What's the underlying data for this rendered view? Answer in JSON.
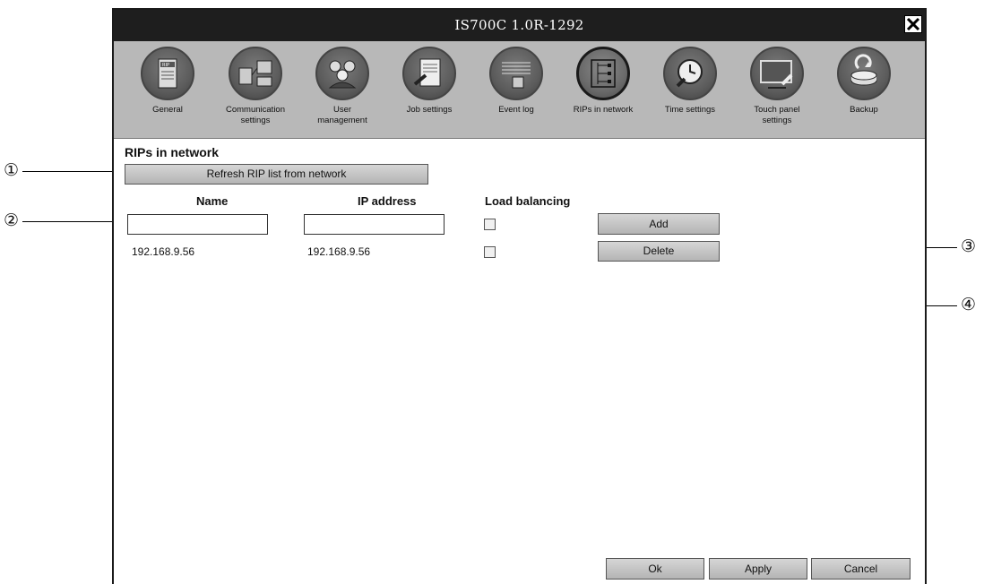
{
  "window": {
    "title": "IS700C 1.0R-1292"
  },
  "toolbar": {
    "items": [
      {
        "label": "General",
        "icon": "rip-server-icon"
      },
      {
        "label": "Communication\nsettings",
        "icon": "network-computers-icon"
      },
      {
        "label": "User\nmanagement",
        "icon": "users-group-icon"
      },
      {
        "label": "Job settings",
        "icon": "document-wrench-icon"
      },
      {
        "label": "Event log",
        "icon": "log-list-icon"
      },
      {
        "label": "RIPs in network",
        "icon": "network-tree-icon",
        "active": true
      },
      {
        "label": "Time settings",
        "icon": "clock-icon"
      },
      {
        "label": "Touch panel\nsettings",
        "icon": "monitor-wrench-icon"
      },
      {
        "label": "Backup",
        "icon": "backup-disk-icon"
      }
    ]
  },
  "content": {
    "section_title": "RIPs in network",
    "refresh_label": "Refresh RIP list from network",
    "col_name": "Name",
    "col_ip": "IP address",
    "col_load": "Load balancing",
    "new_entry": {
      "name": "",
      "ip": "",
      "load_balancing": false
    },
    "rows": [
      {
        "name": "192.168.9.56",
        "ip": "192.168.9.56",
        "load_balancing": false
      }
    ],
    "add_label": "Add",
    "delete_label": "Delete"
  },
  "footer": {
    "ok_label": "Ok",
    "apply_label": "Apply",
    "cancel_label": "Cancel"
  },
  "callouts": [
    "①",
    "②",
    "③",
    "④"
  ]
}
